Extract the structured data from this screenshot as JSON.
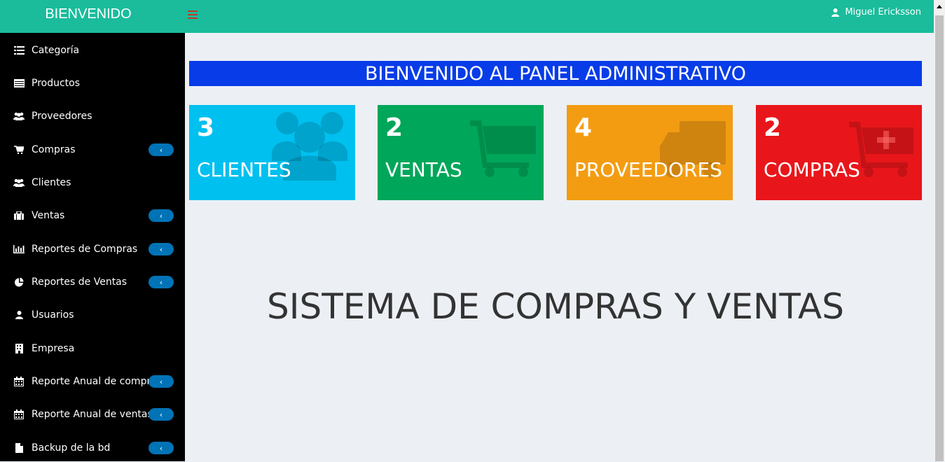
{
  "header": {
    "brand": "BIENVENIDO",
    "user_name": "Miguel Ericksson"
  },
  "sidebar": {
    "items": [
      {
        "label": "Categoría",
        "icon": "list-icon",
        "submenu": false
      },
      {
        "label": "Productos",
        "icon": "table-icon",
        "submenu": false
      },
      {
        "label": "Proveedores",
        "icon": "users-icon",
        "submenu": false
      },
      {
        "label": "Compras",
        "icon": "cart-icon",
        "submenu": true
      },
      {
        "label": "Clientes",
        "icon": "users-icon",
        "submenu": false
      },
      {
        "label": "Ventas",
        "icon": "briefcase-icon",
        "submenu": true
      },
      {
        "label": "Reportes de Compras",
        "icon": "bar-chart-icon",
        "submenu": true
      },
      {
        "label": "Reportes de Ventas",
        "icon": "pie-chart-icon",
        "submenu": true
      },
      {
        "label": "Usuarios",
        "icon": "user-icon",
        "submenu": false
      },
      {
        "label": "Empresa",
        "icon": "building-icon",
        "submenu": false
      },
      {
        "label": "Reporte Anual de compras",
        "icon": "calendar-icon",
        "submenu": true
      },
      {
        "label": "Reporte Anual de ventas",
        "icon": "calendar-icon",
        "submenu": true
      },
      {
        "label": "Backup de la bd",
        "icon": "file-icon",
        "submenu": true
      }
    ],
    "chevron": "‹"
  },
  "main": {
    "banner": "BIENVENIDO AL PANEL ADMINISTRATIVO",
    "title": "SISTEMA DE COMPRAS Y VENTAS",
    "boxes": [
      {
        "count": "3",
        "label": "CLIENTES",
        "color": "#00c0ef",
        "icon": "users-icon"
      },
      {
        "count": "2",
        "label": "VENTAS",
        "color": "#00a65a",
        "icon": "cart-icon"
      },
      {
        "count": "4",
        "label": "PROVEEDORES",
        "color": "#f39c12",
        "icon": "truck-icon"
      },
      {
        "count": "2",
        "label": "COMPRAS",
        "color": "#e8161a",
        "icon": "cart-plus-icon"
      }
    ]
  },
  "colors": {
    "header": "#1abc9c",
    "sidebar": "#000000",
    "banner": "#073ce8",
    "pill": "#0073b7"
  }
}
